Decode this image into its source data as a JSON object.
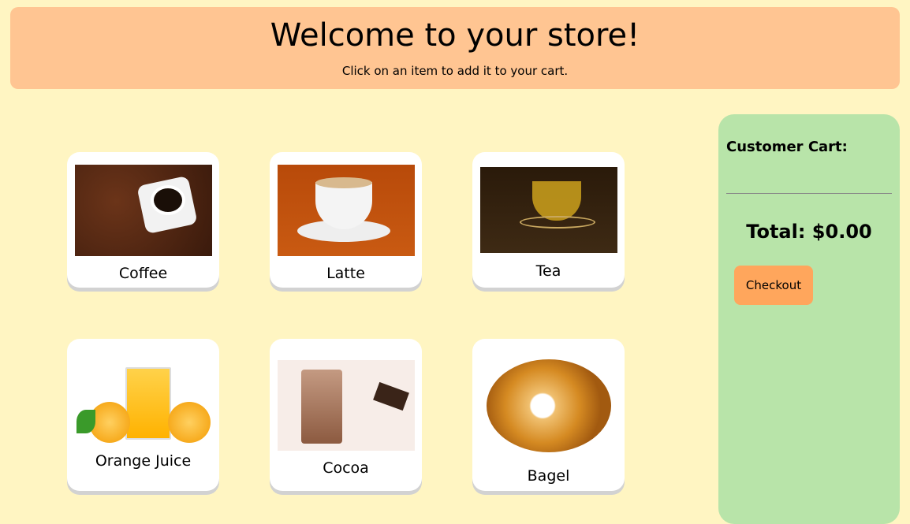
{
  "header": {
    "title": "Welcome to your store!",
    "subtitle": "Click on an item to add it to your cart."
  },
  "items": [
    {
      "name": "Coffee"
    },
    {
      "name": "Latte"
    },
    {
      "name": "Tea"
    },
    {
      "name": "Orange Juice"
    },
    {
      "name": "Cocoa"
    },
    {
      "name": "Bagel"
    }
  ],
  "cart": {
    "title": "Customer Cart:",
    "total": "Total: $0.00",
    "checkout_label": "Checkout"
  },
  "colors": {
    "background": "#fff5c2",
    "header": "#ffc592",
    "cart": "#b8e4a9",
    "checkout": "#ffa65c"
  }
}
